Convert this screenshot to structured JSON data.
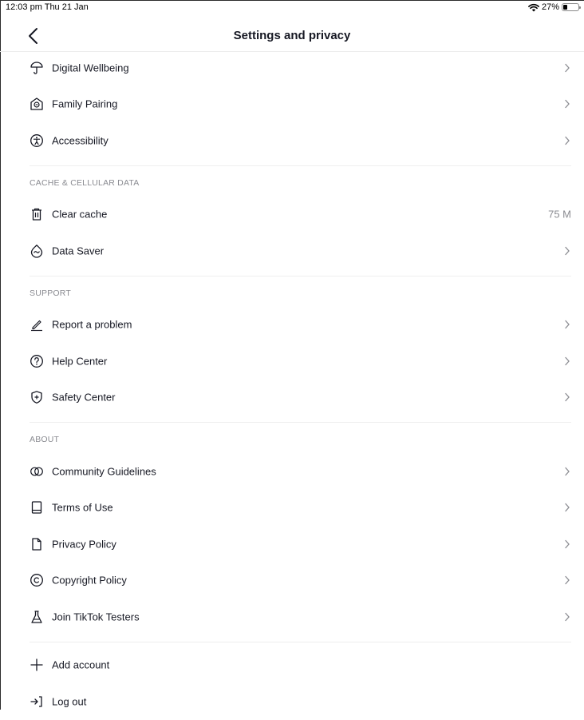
{
  "status_bar": {
    "time": "12:03 pm  Thu 21 Jan",
    "battery": "27%",
    "battery_level": 0.27
  },
  "header": {
    "title": "Settings and privacy"
  },
  "rows_top": [
    {
      "label": "Digital Wellbeing",
      "icon": "umbrella-icon"
    },
    {
      "label": "Family Pairing",
      "icon": "family-home-icon"
    },
    {
      "label": "Accessibility",
      "icon": "accessibility-icon"
    }
  ],
  "cache": {
    "header": "CACHE & CELLULAR DATA",
    "clear_cache": {
      "label": "Clear cache",
      "value": "75 M",
      "icon": "trash-icon"
    },
    "data_saver": {
      "label": "Data Saver",
      "icon": "data-saver-icon"
    }
  },
  "support": {
    "header": "SUPPORT",
    "items": [
      {
        "label": "Report a problem",
        "icon": "pencil-icon"
      },
      {
        "label": "Help Center",
        "icon": "question-icon"
      },
      {
        "label": "Safety Center",
        "icon": "shield-plus-icon"
      }
    ]
  },
  "about": {
    "header": "ABOUT",
    "items": [
      {
        "label": "Community Guidelines",
        "icon": "overlapping-circles-icon"
      },
      {
        "label": "Terms of Use",
        "icon": "book-icon"
      },
      {
        "label": "Privacy Policy",
        "icon": "document-icon"
      },
      {
        "label": "Copyright Policy",
        "icon": "copyright-icon"
      },
      {
        "label": "Join TikTok Testers",
        "icon": "flask-icon"
      }
    ]
  },
  "account": {
    "add_account": {
      "label": "Add account",
      "icon": "plus-icon"
    },
    "log_out": {
      "label": "Log out",
      "icon": "logout-icon"
    }
  }
}
